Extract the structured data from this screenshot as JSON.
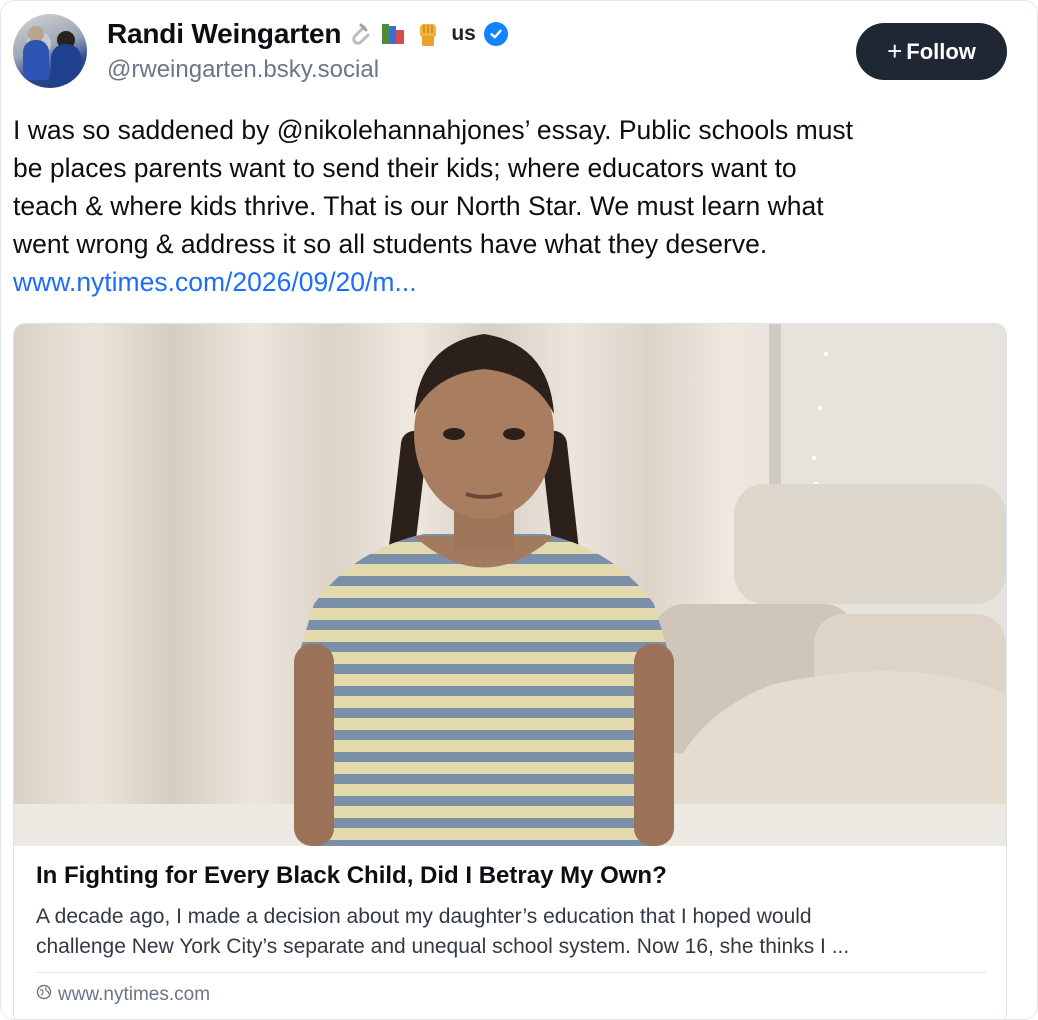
{
  "author": {
    "display_name": "Randi Weingarten",
    "badges": [
      "paperclip-icon",
      "books-icon",
      "raised-fist-icon"
    ],
    "country_code": "us",
    "verified": true,
    "handle": "@rweingarten.bsky.social"
  },
  "follow_button": {
    "label": "Follow",
    "icon": "plus-icon"
  },
  "post": {
    "text_lines": [
      "I was so saddened by @nikolehannahjones’ essay. Public schools must",
      "be places parents want to send their kids; where educators want to",
      "teach & where kids thrive. That is our North Star. We must learn what",
      "went wrong & address it so all students have what they deserve."
    ],
    "link_text": "www.nytimes.com/2026/09/20/m..."
  },
  "embed": {
    "image_icon": "photo-of-girl-with-braids",
    "title": "In Fighting for Every Black Child, Did I Betray My Own?",
    "description_lines": [
      "A decade ago, I made a decision about my daughter’s education that I hoped would",
      "challenge New York City’s separate and unequal school system. Now 16, she thinks I ..."
    ],
    "source": "www.nytimes.com",
    "source_icon": "globe-icon"
  },
  "colors": {
    "link": "#1d6ef5",
    "follow_bg": "#1f2734",
    "verified": "#1083fe",
    "muted": "#6b7785"
  }
}
